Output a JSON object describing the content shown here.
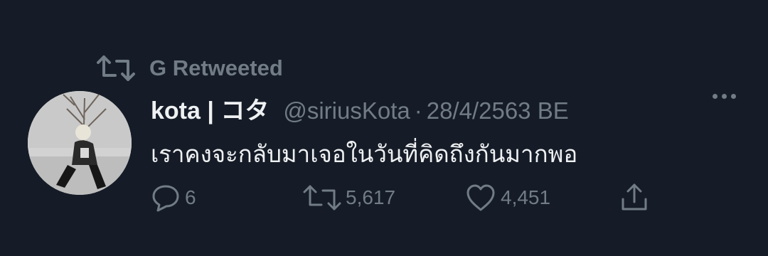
{
  "retweet_banner": {
    "icon": "retweet-icon",
    "label": "G Retweeted"
  },
  "tweet": {
    "author": {
      "display_name": "kota | コタ",
      "handle": "@siriusKota",
      "avatar": "avatar"
    },
    "separator": "·",
    "timestamp": "28/4/2563 BE",
    "text": "เราคงจะกลับมาเจอในวันที่คิดถึงกันมากพอ",
    "more_icon": "more-icon"
  },
  "actions": {
    "reply": {
      "icon": "reply-icon",
      "count": "6"
    },
    "retweet": {
      "icon": "retweet-icon",
      "count": "5,617"
    },
    "like": {
      "icon": "heart-icon",
      "count": "4,451"
    },
    "share": {
      "icon": "share-icon"
    }
  },
  "colors": {
    "background": "#151c27",
    "text_primary": "#eef0f2",
    "text_secondary": "#717c87"
  }
}
